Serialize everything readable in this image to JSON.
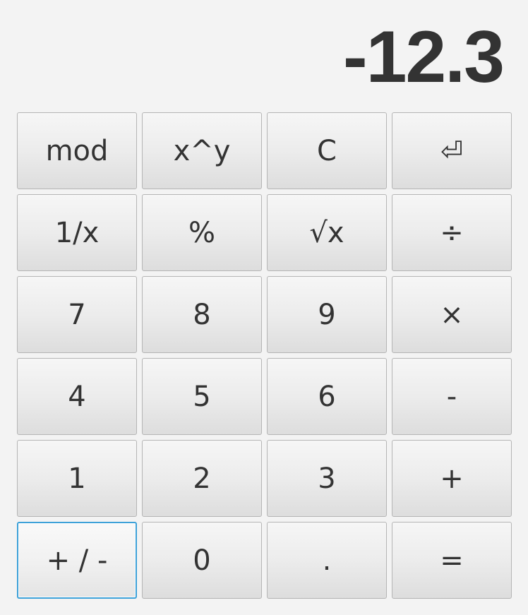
{
  "display": {
    "value": "-12.3"
  },
  "keys": {
    "mod": "mod",
    "power": "x^y",
    "clear": "C",
    "backspace": "⏎",
    "reciprocal": "1/x",
    "percent": "%",
    "sqrt": "√x",
    "divide": "÷",
    "d7": "7",
    "d8": "8",
    "d9": "9",
    "multiply": "×",
    "d4": "4",
    "d5": "5",
    "d6": "6",
    "subtract": "-",
    "d1": "1",
    "d2": "2",
    "d3": "3",
    "add": "+",
    "negate": "+ / -",
    "d0": "0",
    "decimal": ".",
    "equals": "="
  },
  "icons": {
    "backspace": "backspace-return-icon"
  },
  "colors": {
    "background": "#f3f3f3",
    "text": "#333333",
    "focus_border": "#3da1d8",
    "key_border": "#b5b5b5"
  }
}
